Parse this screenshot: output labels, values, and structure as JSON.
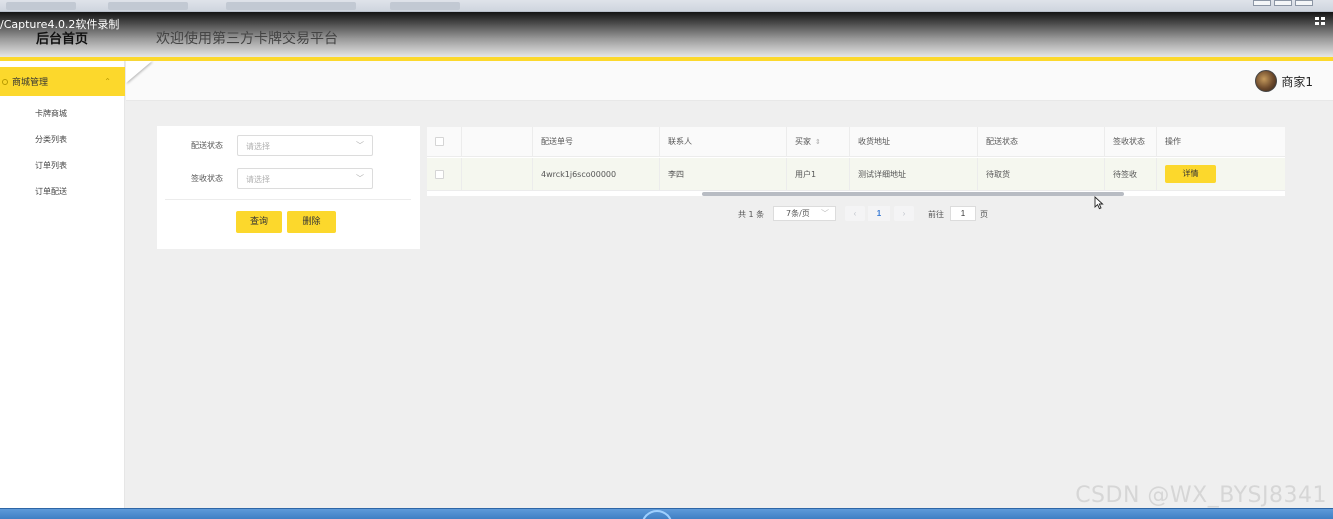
{
  "recorder": {
    "watermark_top": "/Capture4.0.2软件录制"
  },
  "header": {
    "brand": "后台首页",
    "site_title": "欢迎使用第三方卡牌交易平台"
  },
  "user": {
    "name": "商家1"
  },
  "sidebar": {
    "group_label": "商城管理",
    "items": [
      {
        "label": "卡牌商城"
      },
      {
        "label": "分类列表"
      },
      {
        "label": "订单列表"
      },
      {
        "label": "订单配送"
      }
    ]
  },
  "filter": {
    "delivery_status_label": "配送状态",
    "delivery_status_placeholder": "请选择",
    "receipt_status_label": "签收状态",
    "receipt_status_placeholder": "请选择",
    "query_button": "查询",
    "delete_button": "删除"
  },
  "table": {
    "columns": [
      "配送单号",
      "联系人",
      "买家",
      "收货地址",
      "配送状态",
      "签收状态",
      "操作"
    ],
    "rows": [
      {
        "delivery_no": "4wrck1j6sco00000",
        "contact": "李四",
        "buyer": "用户1",
        "address": "测试详细地址",
        "delivery_status": "待取货",
        "receipt_status": "待签收",
        "action": "详情"
      }
    ]
  },
  "pagination": {
    "total": "共 1 条",
    "page_size": "7条/页",
    "current_page": "1",
    "goto_label": "前往",
    "goto_value": "1",
    "page_suffix": "页"
  },
  "footer": {
    "watermark": "CSDN @WX_BYSJ8341"
  },
  "colors": {
    "accent": "#fcd82c",
    "page_bg": "#efefef",
    "link": "#3a7bd5"
  }
}
